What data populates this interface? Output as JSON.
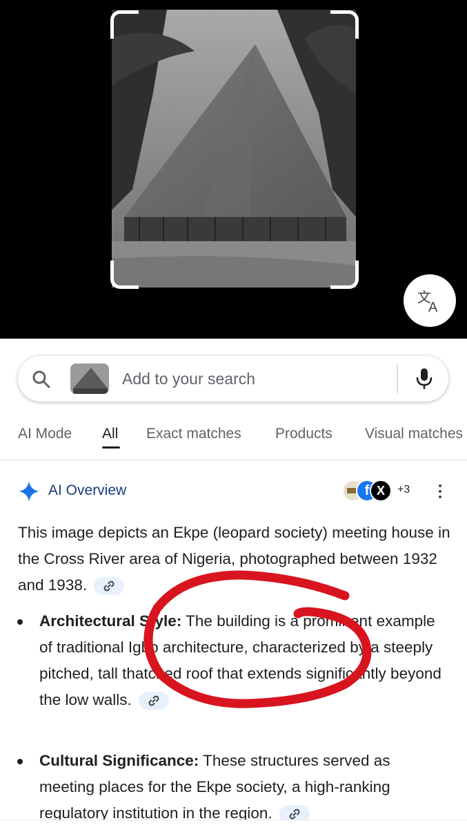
{
  "search": {
    "placeholder": "Add to your search"
  },
  "tabs": [
    {
      "label": "AI Mode"
    },
    {
      "label": "All"
    },
    {
      "label": "Exact matches"
    },
    {
      "label": "Products"
    },
    {
      "label": "Visual matches"
    }
  ],
  "ai_overview": {
    "title": "AI Overview",
    "source_count": "+3",
    "intro": "This image depicts an Ekpe (leopard society) meeting house in the Cross River area of Nigeria, photographed between 1932 and 1938.",
    "bullets": [
      {
        "heading": "Architectural Style:",
        "text": "The building is a prominent example of traditional Igbo architecture, characterized by a steeply pitched, tall thatched roof that extends significantly beyond the low walls."
      },
      {
        "heading": "Cultural Significance:",
        "text": "These structures served as meeting places for the Ekpe society, a high-ranking regulatory institution in the region."
      }
    ]
  },
  "colors": {
    "accent_blue": "#1a73e8",
    "annotation_red": "#d8141f"
  },
  "icons": [
    "translate-icon",
    "search-icon",
    "mic-icon",
    "sparkle-icon",
    "link-icon",
    "more-vert-icon"
  ]
}
